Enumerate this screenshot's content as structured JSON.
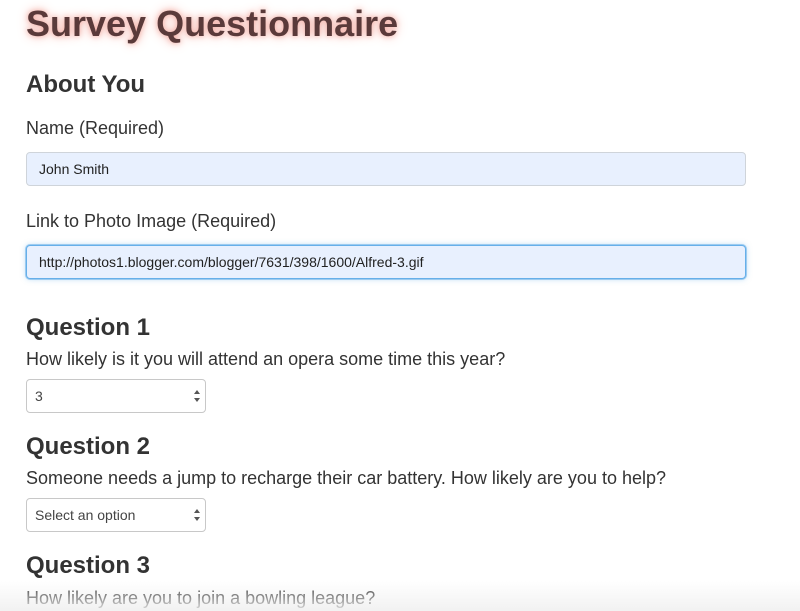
{
  "page": {
    "title": "Survey Questionnaire"
  },
  "about": {
    "heading": "About You",
    "name_label": "Name (Required)",
    "name_value": "John Smith",
    "photo_label": "Link to Photo Image (Required)",
    "photo_value": "http://photos1.blogger.com/blogger/7631/398/1600/Alfred-3.gif"
  },
  "questions": [
    {
      "heading": "Question 1",
      "text": "How likely is it you will attend an opera some time this year?",
      "selected": "3"
    },
    {
      "heading": "Question 2",
      "text": "Someone needs a jump to recharge their car battery. How likely are you to help?",
      "selected": "Select an option"
    },
    {
      "heading": "Question 3",
      "text": "How likely are you to join a bowling league?"
    }
  ],
  "icons": {
    "select_arrow": "chevron-up-down-icon"
  },
  "colors": {
    "title_text": "#5a3a3a",
    "title_glow": "#f3a9a0",
    "autofill_bg": "#e8f0fe",
    "focus_ring": "#66afe9"
  }
}
